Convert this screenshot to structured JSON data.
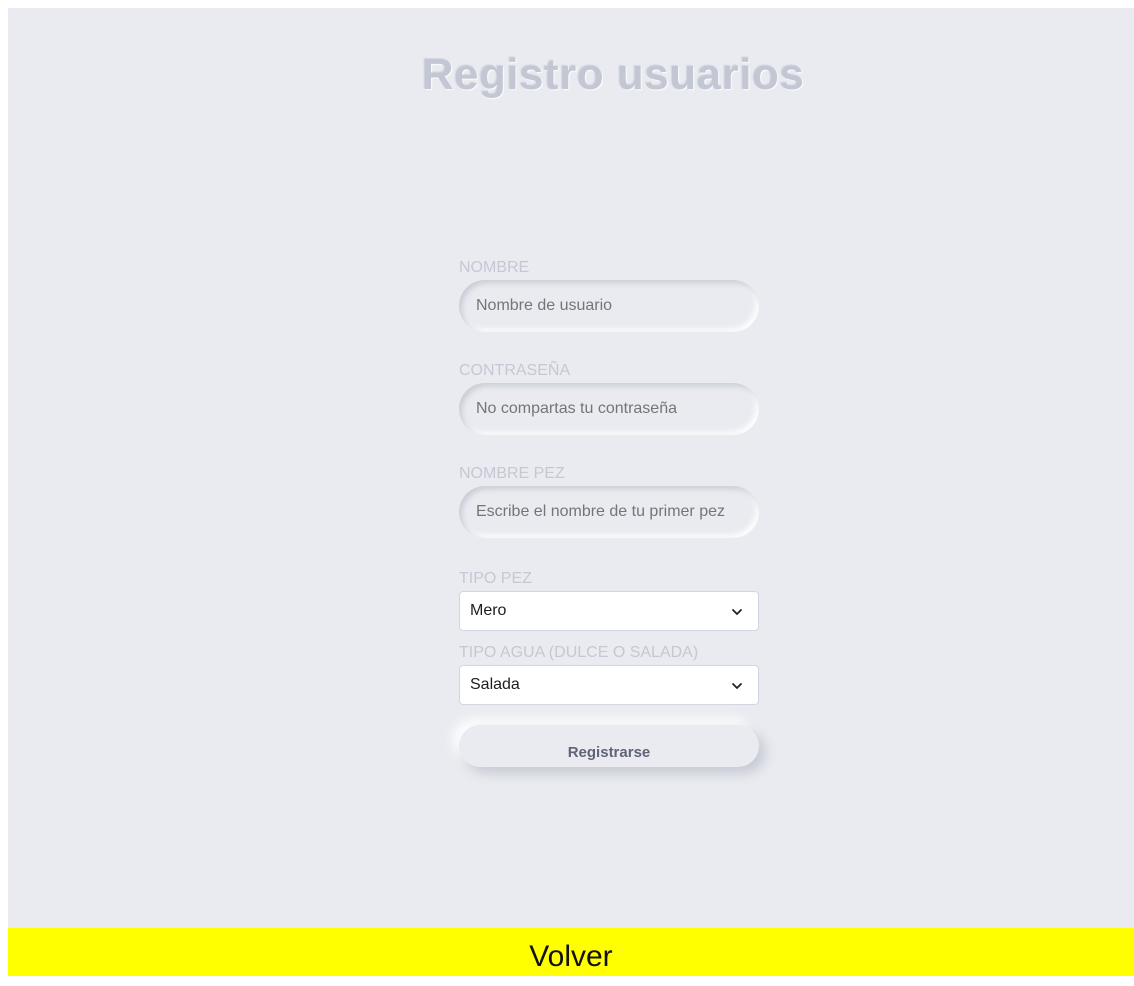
{
  "page": {
    "title": "Registro usuarios"
  },
  "form": {
    "nombre": {
      "label": "NOMBRE",
      "placeholder": "Nombre de usuario"
    },
    "contrasena": {
      "label": "CONTRASEÑA",
      "placeholder": "No compartas tu contraseña"
    },
    "nombre_pez": {
      "label": "NOMBRE PEZ",
      "placeholder": "Escribe el nombre de tu primer pez"
    },
    "tipo_pez": {
      "label": "TIPO PEZ",
      "selected": "Mero"
    },
    "tipo_agua": {
      "label": "TIPO AGUA (DULCE O SALADA)",
      "selected": "Salada"
    },
    "submit_label": "Registrarse"
  },
  "footer": {
    "back_label": "Volver"
  },
  "icons": {
    "select_arrow": "chevron-down-icon"
  },
  "colors": {
    "background": "#e9ebf0",
    "footer": "#ffff00",
    "button_text": "#5f6478"
  }
}
